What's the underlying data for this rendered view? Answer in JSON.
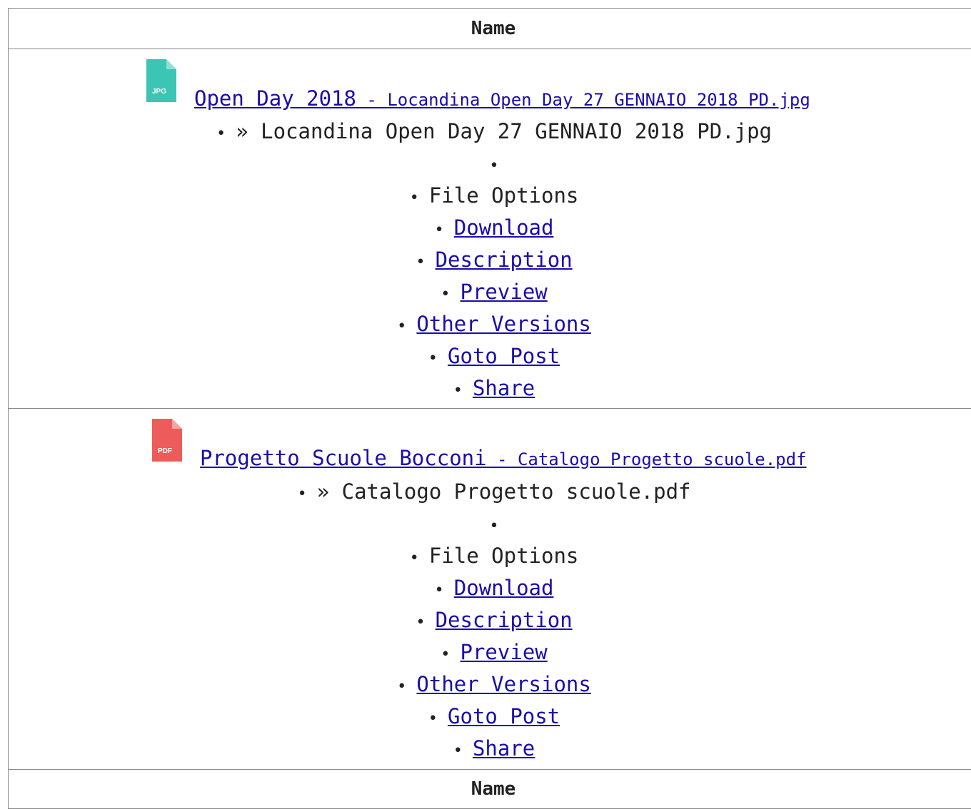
{
  "table": {
    "header_label": "Name",
    "footer_label": "Name"
  },
  "files": [
    {
      "icon": "jpg-file-icon",
      "icon_text": "JPG",
      "icon_color": "#3cc4b4",
      "title": "Open Day 2018",
      "separator": " - ",
      "filename": "Locandina Open Day 27 GENNAIO 2018 PD.jpg",
      "breadcrumb": "» Locandina Open Day 27 GENNAIO 2018 PD.jpg",
      "options_label": "File Options",
      "actions": [
        "Download",
        "Description",
        "Preview",
        "Other Versions",
        "Goto Post",
        "Share"
      ]
    },
    {
      "icon": "pdf-file-icon",
      "icon_text": "PDF",
      "icon_color": "#ee5b5b",
      "title": "Progetto Scuole Bocconi",
      "separator": " - ",
      "filename": "Catalogo Progetto scuole.pdf",
      "breadcrumb": "» Catalogo Progetto scuole.pdf",
      "options_label": "File Options",
      "actions": [
        "Download",
        "Description",
        "Preview",
        "Other Versions",
        "Goto Post",
        "Share"
      ]
    }
  ]
}
